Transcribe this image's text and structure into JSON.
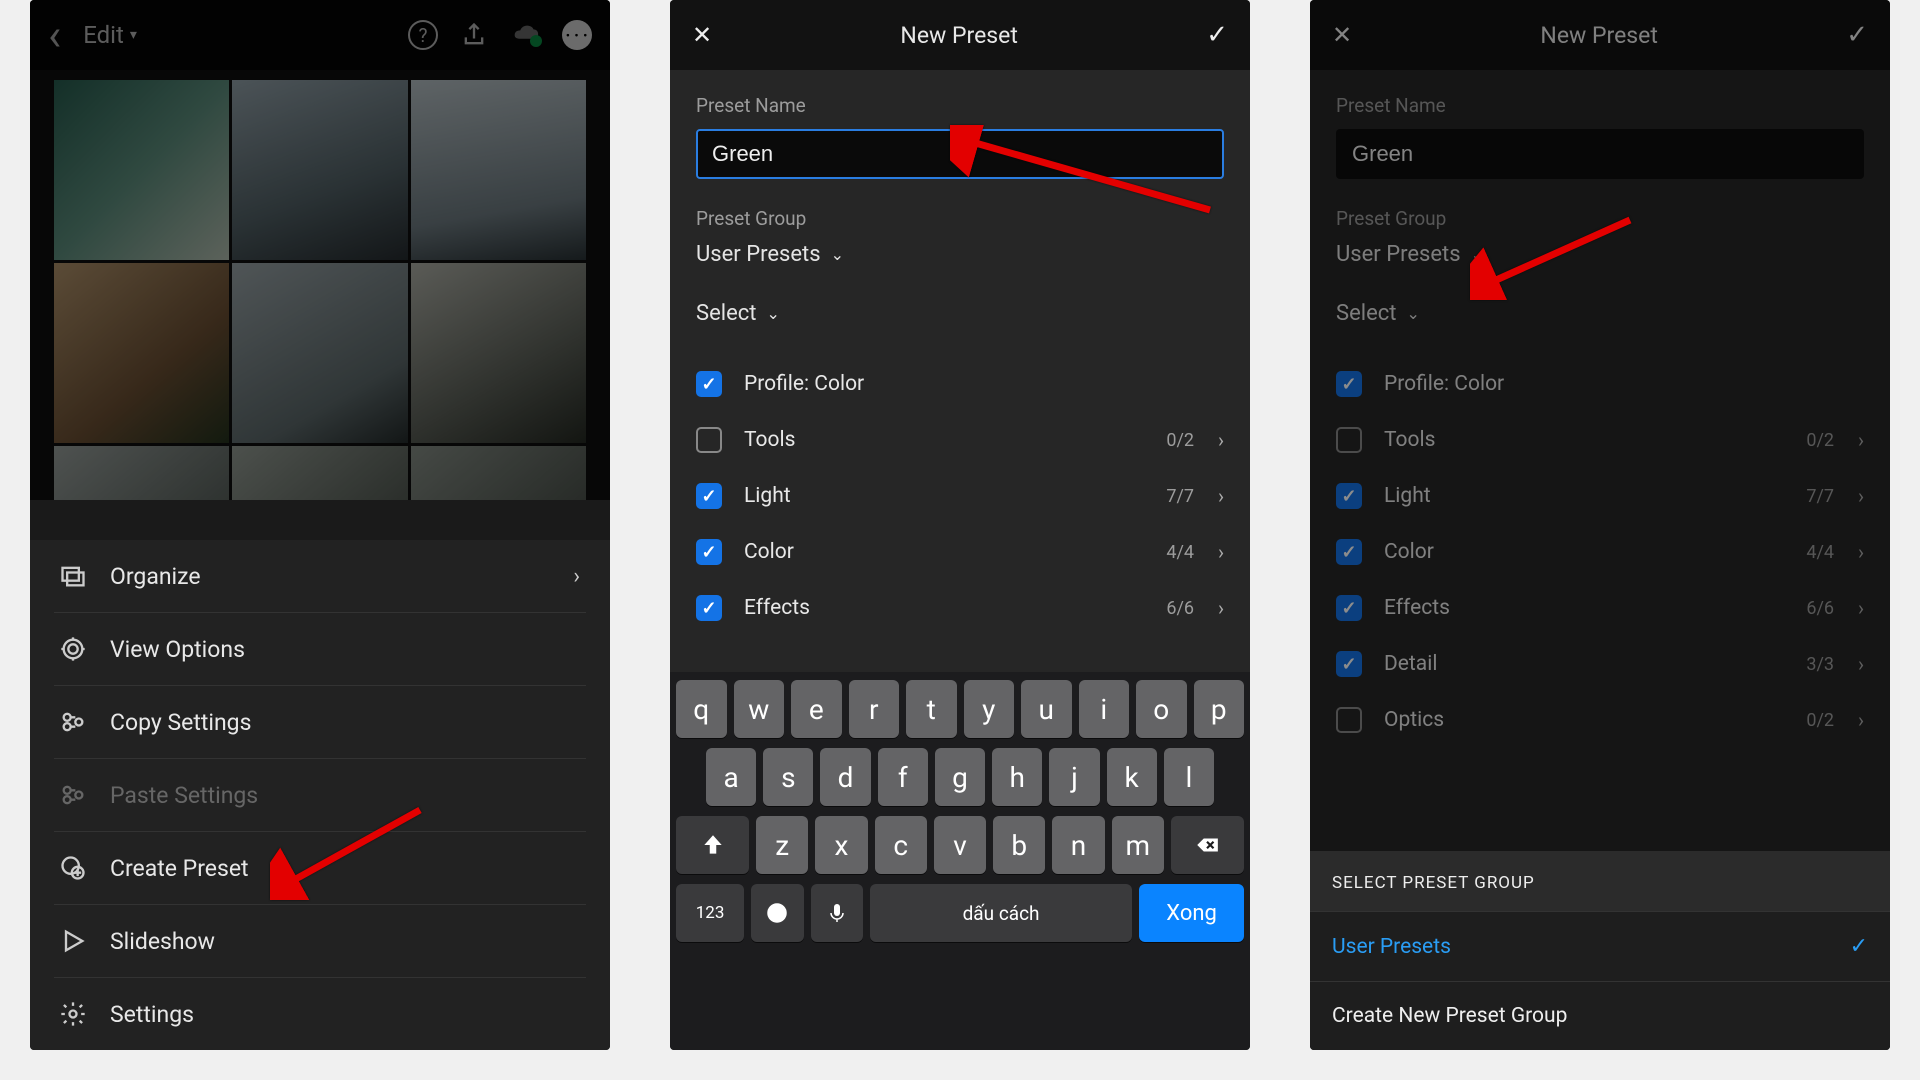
{
  "panel1": {
    "edit_label": "Edit",
    "menu": {
      "organize": "Organize",
      "view_options": "View Options",
      "copy_settings": "Copy Settings",
      "paste_settings": "Paste Settings",
      "create_preset": "Create Preset",
      "slideshow": "Slideshow",
      "settings": "Settings"
    }
  },
  "panel2": {
    "title": "New Preset",
    "preset_name_label": "Preset Name",
    "preset_name_value": "Green",
    "preset_group_label": "Preset Group",
    "preset_group_value": "User Presets",
    "select_label": "Select",
    "options": {
      "profile": {
        "label": "Profile: Color",
        "checked": true,
        "count": ""
      },
      "tools": {
        "label": "Tools",
        "checked": false,
        "count": "0/2"
      },
      "light": {
        "label": "Light",
        "checked": true,
        "count": "7/7"
      },
      "color": {
        "label": "Color",
        "checked": true,
        "count": "4/4"
      },
      "effects": {
        "label": "Effects",
        "checked": true,
        "count": "6/6"
      }
    },
    "keyboard_space": "dấu cách",
    "keyboard_done": "Xong",
    "keyboard_123": "123"
  },
  "panel3": {
    "title": "New Preset",
    "preset_name_label": "Preset Name",
    "preset_name_value": "Green",
    "preset_group_label": "Preset Group",
    "preset_group_value": "User Presets",
    "select_label": "Select",
    "options": {
      "profile": {
        "label": "Profile: Color",
        "checked": true,
        "count": ""
      },
      "tools": {
        "label": "Tools",
        "checked": false,
        "count": "0/2"
      },
      "light": {
        "label": "Light",
        "checked": true,
        "count": "7/7"
      },
      "color": {
        "label": "Color",
        "checked": true,
        "count": "4/4"
      },
      "effects": {
        "label": "Effects",
        "checked": true,
        "count": "6/6"
      },
      "detail": {
        "label": "Detail",
        "checked": true,
        "count": "3/3"
      },
      "optics": {
        "label": "Optics",
        "checked": false,
        "count": "0/2"
      }
    },
    "group_section_title": "SELECT PRESET GROUP",
    "group_selected": "User Presets",
    "group_new": "Create New Preset Group"
  }
}
